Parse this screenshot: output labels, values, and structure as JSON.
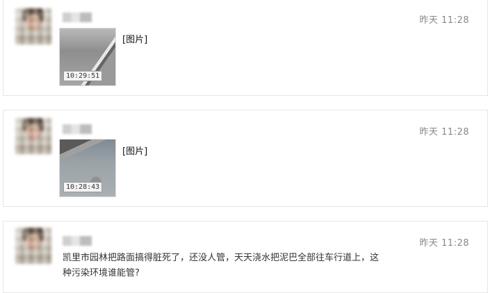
{
  "posts": [
    {
      "time": "昨天 11:28",
      "image_label": "[图片]",
      "thumb_stamp": "10:29:51"
    },
    {
      "time": "昨天 11:28",
      "image_label": "[图片]",
      "thumb_stamp": "10:28:43"
    },
    {
      "time": "昨天 11:28",
      "message_line1": "凯里市园林把路面搞得脏死了，还没人管，天天浇水把泥巴全部往车行道上，这",
      "message_line2": "种污染环境谁能管?"
    }
  ],
  "colors": {
    "background": "#ffffff",
    "border": "#e6e6e6",
    "time_text": "#888888",
    "body_text": "#333333"
  }
}
